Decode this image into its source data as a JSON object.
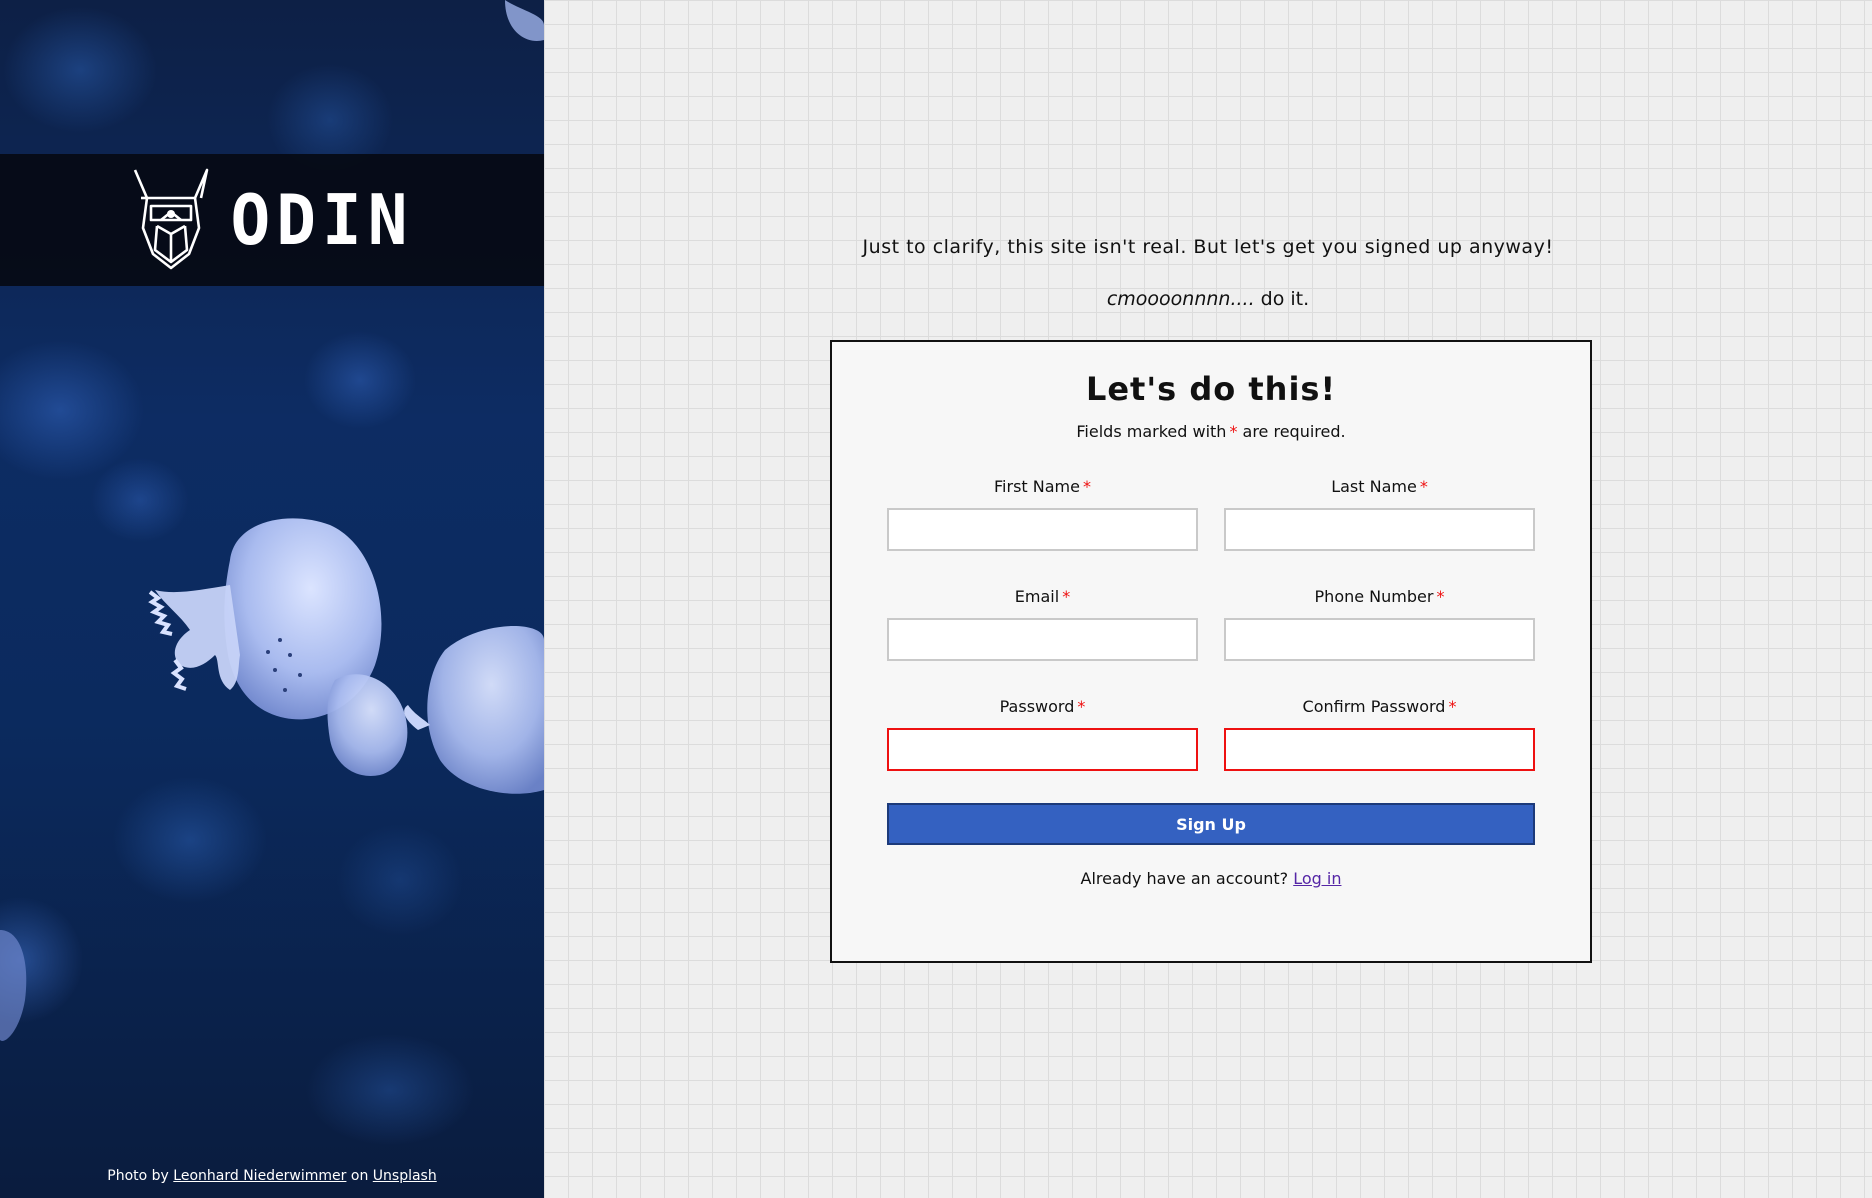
{
  "brand": {
    "name": "ODIN",
    "logo_icon": "viking-helmet-icon"
  },
  "credit": {
    "prefix": "Photo by",
    "author": "Leonhard Niederwimmer",
    "joiner": "on",
    "source": "Unsplash"
  },
  "intro": {
    "line1": "Just to clarify, this site isn't real. But let's get you signed up anyway!",
    "line2_em": "cmoooonnnn....",
    "line2_rest": " do it."
  },
  "form": {
    "title": "Let's do this!",
    "required_note_before": "Fields marked with",
    "required_marker": "*",
    "required_note_after": " are required.",
    "fields": {
      "first_name": {
        "label": "First Name",
        "value": ""
      },
      "last_name": {
        "label": "Last Name",
        "value": ""
      },
      "email": {
        "label": "Email",
        "value": ""
      },
      "phone": {
        "label": "Phone Number",
        "value": ""
      },
      "password": {
        "label": "Password",
        "value": ""
      },
      "confirm_password": {
        "label": "Confirm Password",
        "value": ""
      }
    },
    "submit_label": "Sign Up",
    "login_prompt": "Already have an account?",
    "login_link": "Log in"
  },
  "colors": {
    "primary_button": "#3461c1",
    "required_asterisk": "#ee1111",
    "invalid_border": "#ee1111",
    "link": "#5526a6"
  }
}
